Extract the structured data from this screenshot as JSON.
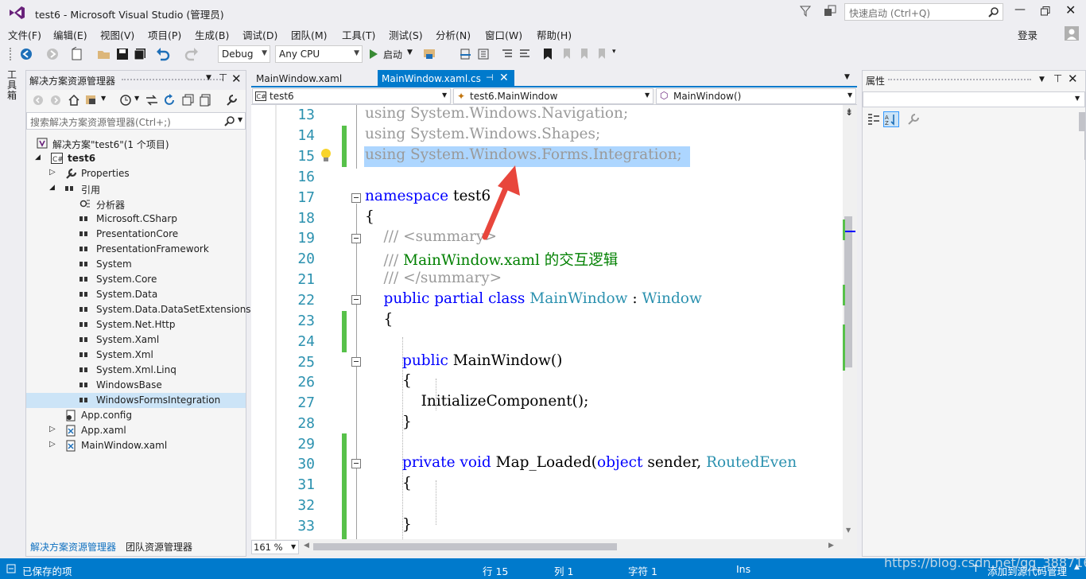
{
  "window": {
    "title": "test6 - Microsoft Visual Studio (管理员)",
    "quick_launch_placeholder": "快速启动 (Ctrl+Q)",
    "login": "登录"
  },
  "menu": [
    "文件(F)",
    "编辑(E)",
    "视图(V)",
    "项目(P)",
    "生成(B)",
    "调试(D)",
    "团队(M)",
    "工具(T)",
    "测试(S)",
    "分析(N)",
    "窗口(W)",
    "帮助(H)"
  ],
  "toolbar": {
    "config": "Debug",
    "platform": "Any CPU",
    "start": "启动"
  },
  "toolbox_strip_label": "工具箱",
  "solution_explorer": {
    "title": "解决方案资源管理器",
    "search_placeholder": "搜索解决方案资源管理器(Ctrl+;)",
    "tree": [
      {
        "label": "解决方案\"test6\"(1 个项目)",
        "icon": "solution-icon"
      },
      {
        "label": "test6",
        "icon": "csharp-project-icon"
      },
      {
        "label": "Properties",
        "icon": "wrench-icon"
      },
      {
        "label": "引用",
        "icon": "reference-icon"
      },
      {
        "label": "分析器",
        "icon": "analyzer-icon"
      },
      {
        "label": "Microsoft.CSharp",
        "icon": "reference-icon"
      },
      {
        "label": "PresentationCore",
        "icon": "reference-icon"
      },
      {
        "label": "PresentationFramework",
        "icon": "reference-icon"
      },
      {
        "label": "System",
        "icon": "reference-icon"
      },
      {
        "label": "System.Core",
        "icon": "reference-icon"
      },
      {
        "label": "System.Data",
        "icon": "reference-icon"
      },
      {
        "label": "System.Data.DataSetExtensions",
        "icon": "reference-icon"
      },
      {
        "label": "System.Net.Http",
        "icon": "reference-icon"
      },
      {
        "label": "System.Xaml",
        "icon": "reference-icon"
      },
      {
        "label": "System.Xml",
        "icon": "reference-icon"
      },
      {
        "label": "System.Xml.Linq",
        "icon": "reference-icon"
      },
      {
        "label": "WindowsBase",
        "icon": "reference-icon"
      },
      {
        "label": "WindowsFormsIntegration",
        "icon": "reference-icon",
        "selected": true
      },
      {
        "label": "App.config",
        "icon": "config-icon"
      },
      {
        "label": "App.xaml",
        "icon": "xaml-icon"
      },
      {
        "label": "MainWindow.xaml",
        "icon": "xaml-icon"
      }
    ],
    "bottom_tabs": [
      "解决方案资源管理器",
      "团队资源管理器"
    ]
  },
  "editor": {
    "tabs": [
      {
        "label": "MainWindow.xaml",
        "active": false
      },
      {
        "label": "MainWindow.xaml.cs",
        "active": true
      }
    ],
    "nav": {
      "project": "test6",
      "class": "test6.MainWindow",
      "member": "MainWindow()"
    },
    "line_numbers": [
      "13",
      "14",
      "15",
      "16",
      "17",
      "18",
      "19",
      "20",
      "21",
      "22",
      "23",
      "24",
      "25",
      "26",
      "27",
      "28",
      "29",
      "30",
      "31",
      "32",
      "33"
    ],
    "zoom": "161 %"
  },
  "properties_panel": {
    "title": "属性"
  },
  "status": {
    "saved": "已保存的项",
    "row": "行 15",
    "col": "列 1",
    "char": "字符 1",
    "mode": "Ins",
    "source_control": "添加到源代码管理"
  },
  "watermark": "https://blog.csdn.net/qq_38871652",
  "colors": {
    "accent": "#007acc",
    "keyword": "#0000ff",
    "type": "#2b91af",
    "comment": "#008000",
    "change_bar": "#57c14a",
    "arrow": "#e8463c",
    "selection": "#add6ff"
  }
}
